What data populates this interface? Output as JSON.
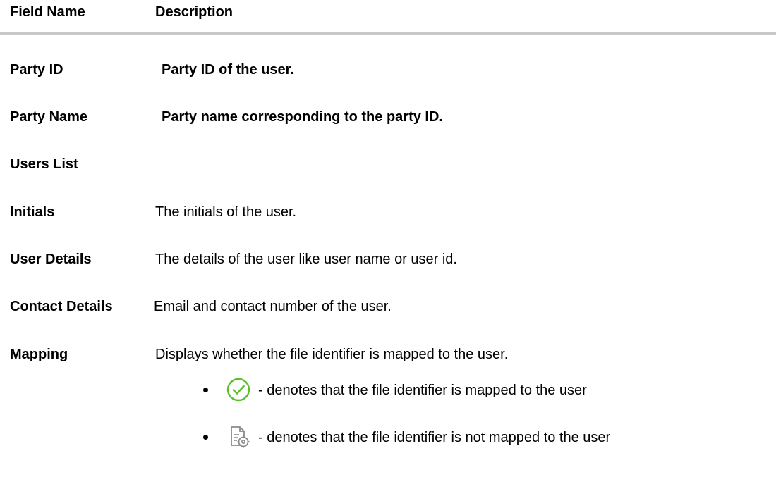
{
  "table": {
    "headers": {
      "field_name": "Field Name",
      "description": "Description"
    },
    "rows": [
      {
        "name": "Party ID",
        "description": "Party ID of the user."
      },
      {
        "name": "Party Name",
        "description": "Party name corresponding to the party ID."
      },
      {
        "name": "Users List",
        "description": ""
      },
      {
        "name": "Initials",
        "description": "The initials of the user."
      },
      {
        "name": "User Details",
        "description": "The details of the user like user name or user id."
      },
      {
        "name": "Contact Details",
        "description": "Email and contact number of the user."
      },
      {
        "name": "Mapping",
        "description": "Displays whether the file identifier is mapped to the user."
      }
    ],
    "mapping_bullets": [
      {
        "icon": "check-circle-icon",
        "text": "- denotes that the file identifier is mapped to the user"
      },
      {
        "icon": "document-settings-icon",
        "text": "- denotes that the file identifier is not mapped to the user"
      }
    ]
  },
  "colors": {
    "check_icon": "#5cbf2a",
    "doc_icon": "#8a8a8a",
    "divider": "#c8c8c8"
  }
}
